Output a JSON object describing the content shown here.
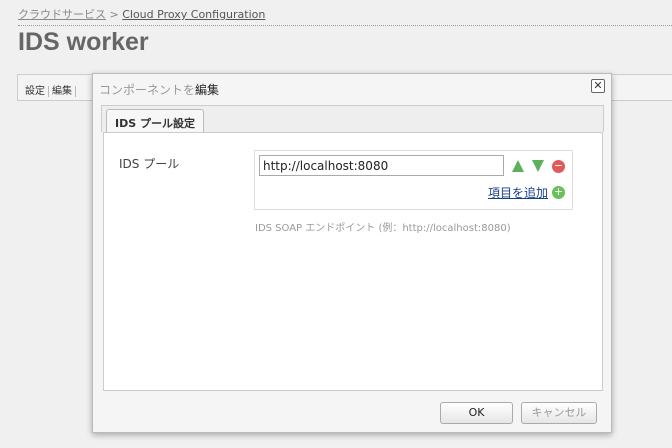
{
  "breadcrumb": {
    "root": "クラウドサービス",
    "sep": ">",
    "current": "Cloud Proxy Configuration"
  },
  "page_title": "IDS worker",
  "toolbar": {
    "settings": "設定",
    "edit": "編集"
  },
  "dialog": {
    "title_prefix": "コンポーネントを",
    "title_suffix": "編集",
    "close": "✕",
    "tab": "IDS プール設定",
    "field_label": "IDS プール",
    "field_value": "http://localhost:8080",
    "add_item": "項目を追加",
    "hint": "IDS SOAP エンドポイント (例：http://localhost:8080)",
    "ok": "OK",
    "cancel": "キャンセル"
  }
}
